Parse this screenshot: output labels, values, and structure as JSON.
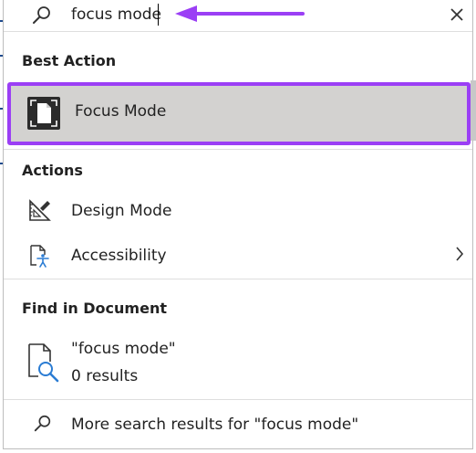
{
  "search": {
    "value": "focus mode",
    "icon": "search-icon",
    "close_icon": "close-icon"
  },
  "annotation": {
    "arrow_color": "#9b3ff5"
  },
  "best_action": {
    "header": "Best Action",
    "item": {
      "label": "Focus Mode",
      "icon": "focus-mode-icon"
    },
    "highlight_color": "#9b3ff5"
  },
  "actions": {
    "header": "Actions",
    "items": [
      {
        "label": "Design Mode",
        "icon": "design-mode-icon"
      },
      {
        "label": "Accessibility",
        "icon": "accessibility-icon",
        "has_submenu": true
      }
    ]
  },
  "find_in_document": {
    "header": "Find in Document",
    "result_title": "\"focus mode\"",
    "result_count": "0 results"
  },
  "more_results": {
    "label": "More search results for \"focus mode\""
  }
}
